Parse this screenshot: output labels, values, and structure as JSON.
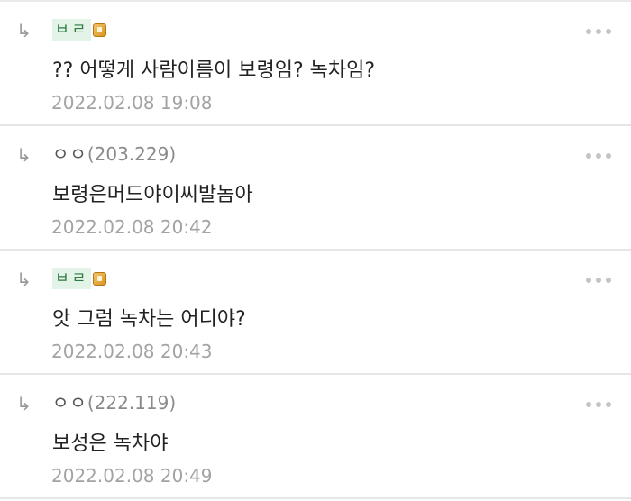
{
  "comments": [
    {
      "reply_icon": "reply-arrow-icon",
      "reply_glyph": "↳",
      "nickname": "ㅂㄹ",
      "type": "member",
      "ip": "",
      "badge_icon": "member-level-badge-icon",
      "text": "?? 어떻게 사람이름이 보령임? 녹차임?",
      "date": "2022.02.08 19:08",
      "more_icon": "more-options-icon"
    },
    {
      "reply_icon": "reply-arrow-icon",
      "reply_glyph": "↳",
      "nickname": "ㅇㅇ",
      "type": "guest",
      "ip": "(203.229)",
      "text": "보령은머드야이씨발놈아",
      "date": "2022.02.08 20:42",
      "more_icon": "more-options-icon"
    },
    {
      "reply_icon": "reply-arrow-icon",
      "reply_glyph": "↳",
      "nickname": "ㅂㄹ",
      "type": "member",
      "ip": "",
      "badge_icon": "member-level-badge-icon",
      "text": "앗 그럼 녹차는 어디야?",
      "date": "2022.02.08 20:43",
      "more_icon": "more-options-icon"
    },
    {
      "reply_icon": "reply-arrow-icon",
      "reply_glyph": "↳",
      "nickname": "ㅇㅇ",
      "type": "guest",
      "ip": "(222.119)",
      "text": "보성은 녹차야",
      "date": "2022.02.08 20:49",
      "more_icon": "more-options-icon"
    }
  ],
  "colors": {
    "member_nick_bg": "#e4f3e7",
    "member_nick_text": "#2c7a3f",
    "divider": "#e6e6e6",
    "date_text": "#a3a3a3"
  }
}
